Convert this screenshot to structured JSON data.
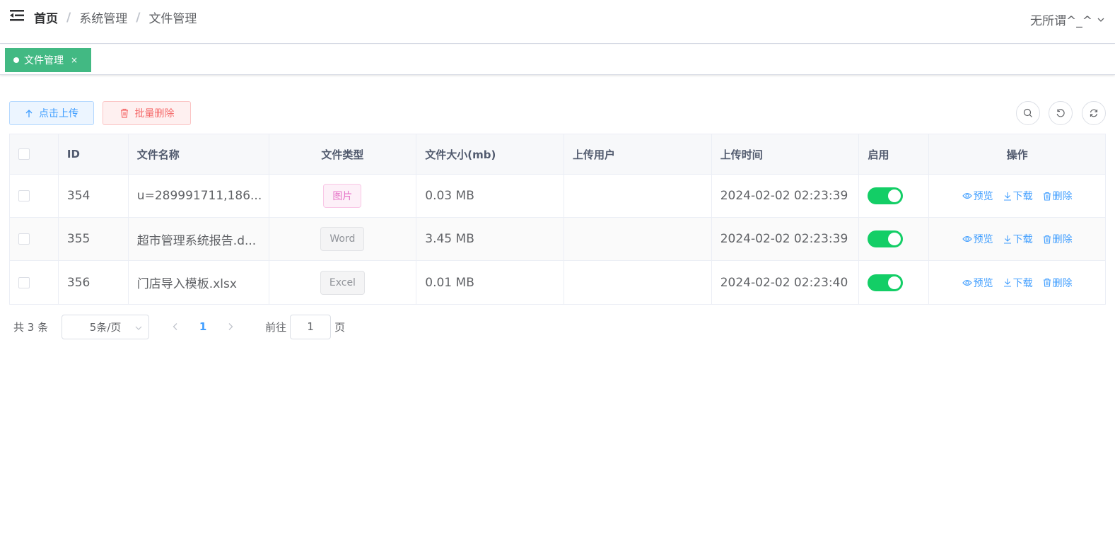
{
  "header": {
    "breadcrumb": [
      "首页",
      "系统管理",
      "文件管理"
    ],
    "user": "无所谓^_^"
  },
  "tags": [
    {
      "label": "文件管理",
      "close": "×"
    }
  ],
  "toolbar": {
    "upload_label": "点击上传",
    "batch_delete_label": "批量删除"
  },
  "table": {
    "columns": [
      "",
      "ID",
      "文件名称",
      "文件类型",
      "文件大小(mb)",
      "上传用户",
      "上传时间",
      "启用",
      "操作"
    ],
    "rows": [
      {
        "id": "354",
        "name": "u=289991711,186...",
        "type": "图片",
        "size": "0.03 MB",
        "user": "",
        "time": "2024-02-02 02:23:39",
        "enabled": true
      },
      {
        "id": "355",
        "name": "超市管理系统报告.d...",
        "type": "Word",
        "size": "3.45 MB",
        "user": "",
        "time": "2024-02-02 02:23:39",
        "enabled": true
      },
      {
        "id": "356",
        "name": "门店导入模板.xlsx",
        "type": "Excel",
        "size": "0.01 MB",
        "user": "",
        "time": "2024-02-02 02:23:40",
        "enabled": true
      }
    ],
    "actions": {
      "preview": "预览",
      "download": "下载",
      "delete": "删除"
    }
  },
  "pagination": {
    "total": "共 3 条",
    "page_size": "5条/页",
    "current": "1",
    "goto_prefix": "前往",
    "goto_value": "1",
    "goto_suffix": "页"
  },
  "colors": {
    "accent": "#409eff",
    "tag_active": "#42b983",
    "switch_on": "#13ce66",
    "danger": "#f56c6c"
  }
}
